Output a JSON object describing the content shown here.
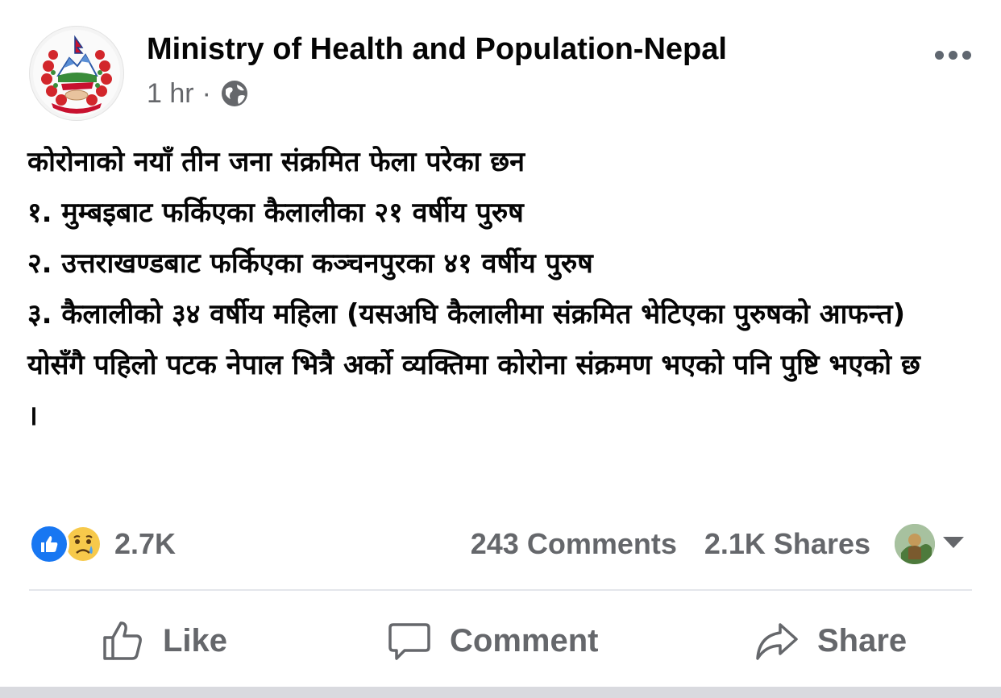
{
  "post": {
    "page_name": "Ministry of Health and Population-Nepal",
    "time": "1 hr",
    "separator": "·",
    "audience_icon": "globe-icon",
    "avatar_icon": "nepal-emblem-logo",
    "more_icon": "more-options-icon",
    "lines": [
      "कोरोनाको नयाँ तीन जना संक्रमित फेला परेका छन",
      "१. मुम्बइबाट फर्किएका कैलालीका २१ वर्षीय पुरुष",
      "२. उत्तराखण्डबाट फर्किएका कञ्चनपुरका ४१ वर्षीय पुरुष",
      "३. कैलालीको ३४ वर्षीय महिला (यसअघि कैलालीमा संक्रमित भेटिएका पुरुषको आफन्त)",
      "योसँगै पहिलो पटक नेपाल भित्रै अर्को व्यक्तिमा कोरोना संक्रमण भएको पनि पुष्टि भएको छ ।"
    ]
  },
  "engagement": {
    "reaction_icons": [
      "like-reaction-icon",
      "sad-reaction-icon"
    ],
    "reaction_count": "2.7K",
    "comments": "243 Comments",
    "shares": "2.1K Shares"
  },
  "actions": {
    "like": "Like",
    "comment": "Comment",
    "share": "Share"
  },
  "colors": {
    "text_primary": "#050505",
    "text_secondary": "#65676b",
    "like_blue": "#1877f2",
    "divider": "#e4e6eb"
  }
}
